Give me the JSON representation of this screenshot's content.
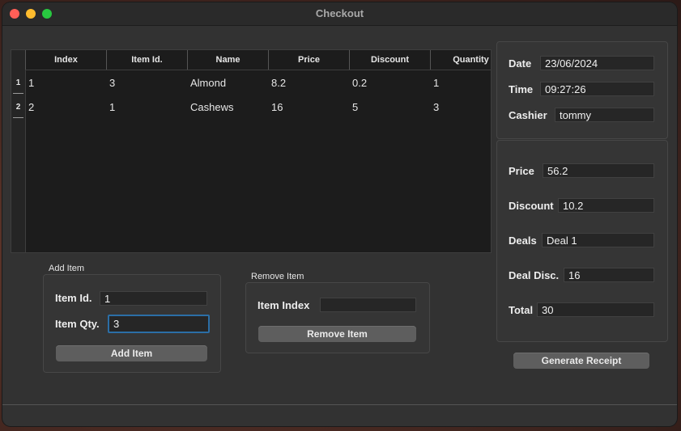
{
  "window": {
    "title": "Checkout"
  },
  "table": {
    "columns": [
      "Index",
      "Item Id.",
      "Name",
      "Price",
      "Discount",
      "Quantity"
    ],
    "rows": [
      {
        "num": "1",
        "cells": [
          "1",
          "3",
          "Almond",
          "8.2",
          "0.2",
          "1"
        ]
      },
      {
        "num": "2",
        "cells": [
          "2",
          "1",
          "Cashews",
          "16",
          "5",
          "3"
        ]
      }
    ]
  },
  "add_item": {
    "group_label": "Add Item",
    "item_id_label": "Item Id.",
    "item_id_value": "1",
    "item_qty_label": "Item Qty.",
    "item_qty_value": "3",
    "button_label": "Add Item"
  },
  "remove_item": {
    "group_label": "Remove Item",
    "index_label": "Item Index",
    "index_value": "",
    "button_label": "Remove Item"
  },
  "info": {
    "date_label": "Date",
    "date_value": "23/06/2024",
    "time_label": "Time",
    "time_value": "09:27:26",
    "cashier_label": "Cashier",
    "cashier_value": "tommy"
  },
  "totals": {
    "price_label": "Price",
    "price_value": "56.2",
    "discount_label": "Discount",
    "discount_value": "10.2",
    "deals_label": "Deals",
    "deals_value": "Deal 1",
    "deal_disc_label": "Deal Disc.",
    "deal_disc_value": "16",
    "total_label": "Total",
    "total_value": "30"
  },
  "generate_button_label": "Generate Receipt",
  "colors": {
    "focus_ring": "#2b6ea6",
    "close": "#ff5f57",
    "minimize": "#febc2e",
    "maximize": "#28c840"
  }
}
